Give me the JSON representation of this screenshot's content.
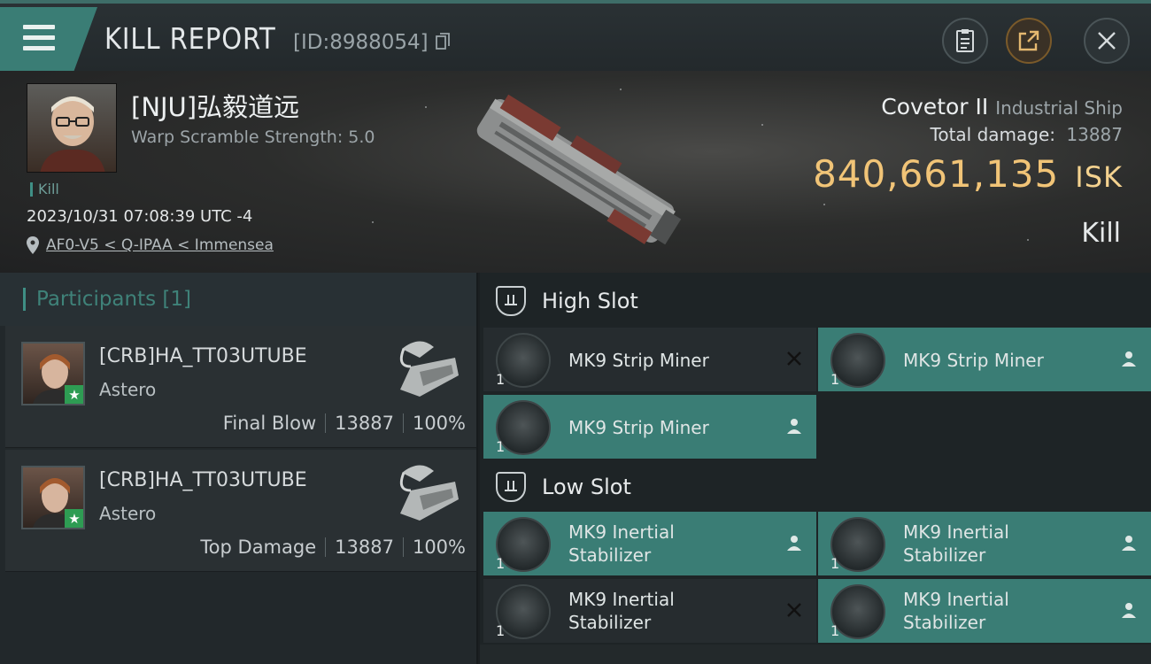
{
  "header": {
    "title": "KILL REPORT",
    "report_id": "[ID:8988054]",
    "icons": [
      "menu-icon",
      "copy-icon",
      "clipboard-icon",
      "share-icon",
      "close-icon"
    ]
  },
  "victim": {
    "name": "[NJU]弘毅道远",
    "warp_scramble": "Warp Scramble Strength: 5.0",
    "tag": "Kill",
    "timestamp": "2023/10/31 07:08:39 UTC -4",
    "location": "AF0-V5 < Q-IPAA < Immensea",
    "ship_name": "Covetor II",
    "ship_type": "Industrial Ship",
    "total_damage_label": "Total damage:",
    "total_damage": "13887",
    "isk_value": "840,661,135",
    "isk_unit": "ISK",
    "result": "Kill"
  },
  "participants": {
    "heading": "Participants",
    "count": "[1]",
    "rows": [
      {
        "name": "[CRB]HA_TT03UTUBE",
        "ship": "Astero",
        "role": "Final Blow",
        "damage": "13887",
        "percent": "100%"
      },
      {
        "name": "[CRB]HA_TT03UTUBE",
        "ship": "Astero",
        "role": "Top Damage",
        "damage": "13887",
        "percent": "100%"
      }
    ]
  },
  "fitting": {
    "high_slot": {
      "label": "High Slot",
      "modules": [
        {
          "name": "MK9 Strip Miner",
          "qty": "1",
          "status": "destroyed"
        },
        {
          "name": "MK9 Strip Miner",
          "qty": "1",
          "status": "dropped"
        },
        {
          "name": "MK9 Strip Miner",
          "qty": "1",
          "status": "dropped"
        }
      ]
    },
    "low_slot": {
      "label": "Low Slot",
      "modules": [
        {
          "name_line1": "MK9 Inertial",
          "name_line2": "Stabilizer",
          "qty": "1",
          "status": "dropped"
        },
        {
          "name_line1": "MK9 Inertial",
          "name_line2": "Stabilizer",
          "qty": "1",
          "status": "dropped"
        },
        {
          "name_line1": "MK9 Inertial",
          "name_line2": "Stabilizer",
          "qty": "1",
          "status": "destroyed"
        },
        {
          "name_line1": "MK9 Inertial",
          "name_line2": "Stabilizer",
          "qty": "1",
          "status": "dropped"
        }
      ]
    }
  },
  "colors": {
    "accent": "#3a7d75",
    "isk": "#f1c477",
    "destroyed_bg": "#262c2f",
    "dropped_bg": "#3a7d75"
  }
}
